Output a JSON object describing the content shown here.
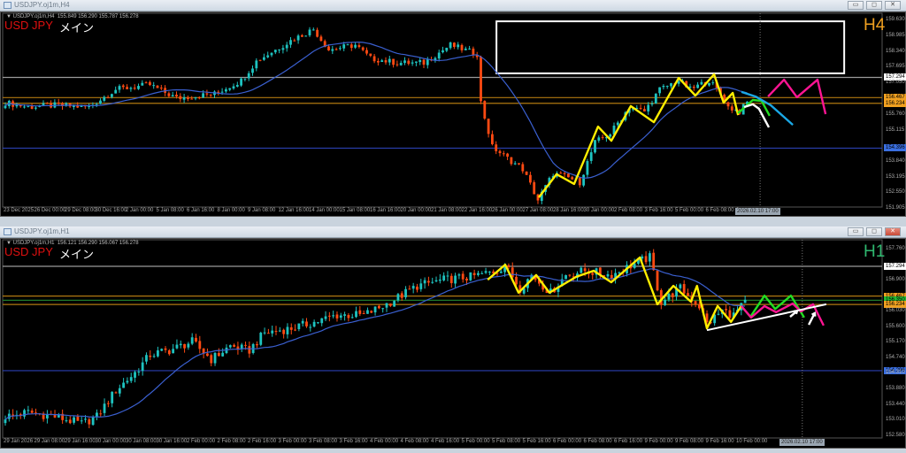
{
  "windows": [
    {
      "title": "USDJPY.oj1m,H4",
      "info": "▼ USDJPY.oj1m,H4  155.849 156.290 155.787 156.278",
      "symbol_label": "USD JPY",
      "main_label": "メイン",
      "timeframe": "H4",
      "timeframe_color": "#f0a020",
      "now_label": "2026.02.10 17:00",
      "buttons": {
        "minimize": "▭",
        "restore": "◻",
        "close": "✕"
      }
    },
    {
      "title": "USDJPY.oj1m,H1",
      "info": "▼ USDJPY.oj1m,H1  156.121 156.290 156.067 156.278",
      "symbol_label": "USD JPY",
      "main_label": "メイン",
      "timeframe": "H1",
      "timeframe_color": "#2fb86f",
      "now_label": "2026.02.10 17:00",
      "buttons": {
        "minimize": "▭",
        "restore": "◻",
        "close": "✕"
      }
    }
  ],
  "colors": {
    "up": "#1ec3c0",
    "down": "#ff4a12",
    "ma": "#3a5fcf",
    "yellow": "#ffee00",
    "green": "#22dd22",
    "magenta": "#ff1493",
    "white": "#ffffff",
    "cyan": "#1aa8e6"
  },
  "chart_data": [
    {
      "type": "candlestick",
      "title": "USDJPY.oj1m,H4",
      "bar_count": 196,
      "now_bar": 198.4,
      "moving_average_period": 20,
      "ylim": [
        151.905,
        159.63
      ],
      "y_ticks": [
        "159.630",
        "158.985",
        "158.340",
        "157.695",
        "157.050",
        "155.760",
        "155.115",
        "153.840",
        "153.195",
        "152.550",
        "151.905"
      ],
      "x_ticks": [
        "23 Dec 2025",
        "26 Dec 00:00",
        "29 Dec 08:00",
        "30 Dec 16:00",
        "2 Jan 00:00",
        "5 Jan 08:00",
        "6 Jan 16:00",
        "8 Jan 00:00",
        "9 Jan 08:00",
        "12 Jan 16:00",
        "14 Jan 00:00",
        "15 Jan 08:00",
        "16 Jan 16:00",
        "20 Jan 00:00",
        "21 Jan 08:00",
        "22 Jan 16:00",
        "26 Jan 00:00",
        "27 Jan 08:00",
        "28 Jan 16:00",
        "30 Jan 00:00",
        "2 Feb 08:00",
        "3 Feb 16:00",
        "5 Feb 00:00",
        "6 Feb 08:00",
        "9"
      ],
      "close_path": [
        [
          0,
          156.26
        ],
        [
          6,
          156.08
        ],
        [
          13,
          156.15
        ],
        [
          22,
          156.08
        ],
        [
          29,
          156.8
        ],
        [
          38,
          156.99
        ],
        [
          45,
          156.44
        ],
        [
          55,
          156.62
        ],
        [
          62,
          157.17
        ],
        [
          66,
          157.96
        ],
        [
          75,
          158.8
        ],
        [
          81,
          159.27
        ],
        [
          85,
          158.43
        ],
        [
          92,
          158.62
        ],
        [
          96,
          158.07
        ],
        [
          103,
          157.89
        ],
        [
          110,
          157.89
        ],
        [
          117,
          158.62
        ],
        [
          124,
          158.25
        ],
        [
          125,
          156.26
        ],
        [
          128,
          154.45
        ],
        [
          131,
          154.09
        ],
        [
          136,
          153.54
        ],
        [
          140,
          152.27
        ],
        [
          144,
          153.36
        ],
        [
          148,
          153.18
        ],
        [
          151,
          153.0
        ],
        [
          155,
          154.63
        ],
        [
          159,
          155.0
        ],
        [
          164,
          156.08
        ],
        [
          168,
          155.9
        ],
        [
          172,
          156.8
        ],
        [
          177,
          157.17
        ],
        [
          180,
          156.8
        ],
        [
          185,
          157.17
        ],
        [
          188,
          156.62
        ],
        [
          190,
          156.08
        ],
        [
          193,
          155.9
        ],
        [
          195,
          156.27
        ]
      ],
      "hlines": [
        {
          "price": 157.294,
          "label": "157.294",
          "color": "#9a9a9a",
          "tag_bg": "#ffffff"
        },
        {
          "price": 156.467,
          "label": "156.467",
          "color": "#b07810",
          "tag_bg": "#f0a020"
        },
        {
          "price": 156.234,
          "label": "156.234",
          "color": "#b07810",
          "tag_bg": "#f0a020"
        },
        {
          "price": 154.396,
          "label": "154.396",
          "color": "#2a3fb0",
          "tag_bg": "#3a6fe0"
        }
      ],
      "rectangle": {
        "bar_from": 129.1,
        "bar_to": 220.5,
        "price_top": 159.59,
        "price_bottom": 157.46,
        "color": "#ffffff"
      },
      "drawings": [
        {
          "name": "yellow-zigzag",
          "color": "yellow",
          "points": [
            [
              140.2,
              152.38
            ],
            [
              144.9,
              153.33
            ],
            [
              149.5,
              152.93
            ],
            [
              155.8,
              155.28
            ],
            [
              159.3,
              154.7
            ],
            [
              164.4,
              156.12
            ],
            [
              170.5,
              155.46
            ],
            [
              177.0,
              157.27
            ],
            [
              181.4,
              156.55
            ],
            [
              186.3,
              157.42
            ],
            [
              188.8,
              156.26
            ],
            [
              191.2,
              156.66
            ],
            [
              192.6,
              155.75
            ]
          ]
        },
        {
          "name": "green-projection",
          "color": "green",
          "points": [
            [
              192.6,
              155.83
            ],
            [
              196.5,
              156.37
            ],
            [
              198.8,
              156.33
            ],
            [
              200.9,
              155.72
            ]
          ]
        },
        {
          "name": "white-projection",
          "color": "white",
          "points": [
            [
              194.2,
              156.08
            ],
            [
              196.5,
              156.19
            ],
            [
              198.1,
              156.01
            ],
            [
              200.7,
              155.25
            ]
          ]
        },
        {
          "name": "cyan-projection",
          "color": "cyan",
          "points": [
            [
              193.5,
              156.7
            ],
            [
              197.2,
              156.51
            ],
            [
              201.2,
              156.15
            ],
            [
              207.0,
              155.35
            ]
          ]
        },
        {
          "name": "magenta-projection",
          "color": "magenta",
          "points": [
            [
              200.5,
              156.51
            ],
            [
              204.7,
              157.2
            ],
            [
              208.1,
              156.48
            ],
            [
              213.5,
              157.2
            ],
            [
              215.6,
              155.79
            ]
          ]
        }
      ]
    },
    {
      "type": "candlestick",
      "title": "USDJPY.oj1m,H1",
      "bar_count": 195,
      "now_bar": 209,
      "moving_average_period": 20,
      "ylim": [
        152.15,
        157.76
      ],
      "y_ticks": [
        "157.760",
        "156.900",
        "156.030",
        "155.600",
        "155.170",
        "154.740",
        "154.310",
        "153.880",
        "153.440",
        "153.010",
        "152.580"
      ],
      "x_ticks": [
        "29 Jan 2026",
        "29 Jan 08:00",
        "29 Jan 16:00",
        "30 Jan 00:00",
        "30 Jan 08:00",
        "30 Jan 16:00",
        "2 Feb 00:00",
        "2 Feb 08:00",
        "2 Feb 16:00",
        "3 Feb 00:00",
        "3 Feb 08:00",
        "3 Feb 16:00",
        "4 Feb 00:00",
        "4 Feb 08:00",
        "4 Feb 16:00",
        "5 Feb 00:00",
        "5 Feb 08:00",
        "5 Feb 16:00",
        "6 Feb 00:00",
        "6 Feb 08:00",
        "6 Feb 16:00",
        "9 Feb 00:00",
        "9 Feb 08:00",
        "9 Feb 16:00",
        "10 Feb 00:00"
      ],
      "close_path": [
        [
          0,
          153.12
        ],
        [
          6,
          153.24
        ],
        [
          13,
          153.12
        ],
        [
          20,
          152.92
        ],
        [
          24,
          153.12
        ],
        [
          29,
          153.85
        ],
        [
          34,
          154.34
        ],
        [
          38,
          154.84
        ],
        [
          43,
          154.96
        ],
        [
          49,
          155.2
        ],
        [
          54,
          154.71
        ],
        [
          59,
          155.08
        ],
        [
          64,
          154.96
        ],
        [
          68,
          155.45
        ],
        [
          75,
          155.57
        ],
        [
          82,
          155.77
        ],
        [
          87,
          155.94
        ],
        [
          94,
          155.94
        ],
        [
          99,
          156.19
        ],
        [
          103,
          156.43
        ],
        [
          108,
          156.75
        ],
        [
          115,
          156.92
        ],
        [
          122,
          157.0
        ],
        [
          129,
          157.17
        ],
        [
          131,
          157.34
        ],
        [
          135,
          156.68
        ],
        [
          138,
          157.05
        ],
        [
          143,
          156.56
        ],
        [
          147,
          157.05
        ],
        [
          152,
          157.17
        ],
        [
          159,
          157.05
        ],
        [
          166,
          157.42
        ],
        [
          169,
          157.54
        ],
        [
          172,
          156.31
        ],
        [
          177,
          156.68
        ],
        [
          182,
          156.19
        ],
        [
          184,
          155.7
        ],
        [
          188,
          156.06
        ],
        [
          191,
          155.94
        ],
        [
          194,
          156.28
        ]
      ],
      "hlines": [
        {
          "price": 157.294,
          "label": "157.294",
          "color": "#9a9a9a",
          "tag_bg": "#ffffff"
        },
        {
          "price": 156.467,
          "label": "156.467",
          "color": "#b07810",
          "tag_bg": "#f0a020"
        },
        {
          "price": 156.35,
          "label": "156.350",
          "color": "#1f7a2a",
          "tag_bg": "#22bb33"
        },
        {
          "price": 156.234,
          "label": "156.234",
          "color": "#b07810",
          "tag_bg": "#f0a020"
        },
        {
          "price": 154.396,
          "label": "154.396",
          "color": "#2a3fb0",
          "tag_bg": "#3a6fe0"
        }
      ],
      "drawings": [
        {
          "name": "yellow-zigzag",
          "color": "yellow",
          "points": [
            [
              126.5,
              156.92
            ],
            [
              131.1,
              157.34
            ],
            [
              134.6,
              156.56
            ],
            [
              139.2,
              157.05
            ],
            [
              142.7,
              156.56
            ],
            [
              149.7,
              157.0
            ],
            [
              154.3,
              157.17
            ],
            [
              158.9,
              156.85
            ],
            [
              166.4,
              157.54
            ],
            [
              171.0,
              156.24
            ],
            [
              175.2,
              156.75
            ],
            [
              179.8,
              156.31
            ],
            [
              181.4,
              156.75
            ],
            [
              184.0,
              155.57
            ],
            [
              186.8,
              156.19
            ],
            [
              190.3,
              155.75
            ],
            [
              193.0,
              156.19
            ]
          ]
        },
        {
          "name": "green-projection",
          "color": "green",
          "points": [
            [
              193.0,
              156.19
            ],
            [
              195.4,
              155.89
            ],
            [
              199.1,
              156.48
            ],
            [
              201.9,
              156.11
            ],
            [
              206.0,
              156.48
            ],
            [
              209.5,
              155.87
            ]
          ]
        },
        {
          "name": "magenta-projection",
          "color": "magenta",
          "points": [
            [
              193.0,
              156.19
            ],
            [
              195.6,
              155.87
            ],
            [
              199.1,
              156.19
            ],
            [
              202.1,
              156.02
            ],
            [
              206.5,
              156.26
            ],
            [
              208.6,
              156.04
            ],
            [
              211.8,
              156.24
            ],
            [
              214.6,
              155.65
            ]
          ]
        },
        {
          "name": "white-trendline",
          "color": "white",
          "points": [
            [
              184.0,
              155.52
            ],
            [
              215.3,
              156.24
            ]
          ]
        },
        {
          "name": "white-arrow-1",
          "color": "white",
          "arrow": true,
          "points": [
            [
              205.8,
              155.89
            ],
            [
              207.7,
              156.06
            ]
          ]
        },
        {
          "name": "white-arrow-2",
          "color": "white",
          "arrow": true,
          "points": [
            [
              210.7,
              155.67
            ],
            [
              212.3,
              156.0
            ]
          ]
        }
      ]
    }
  ]
}
